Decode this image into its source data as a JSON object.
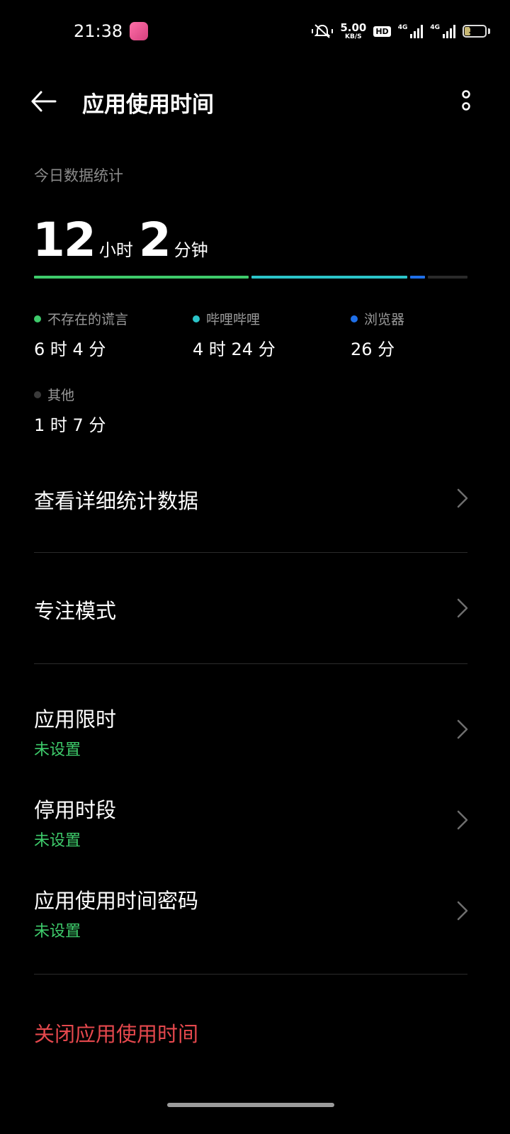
{
  "status_bar": {
    "time": "21:38",
    "net_speed_value": "5.00",
    "net_speed_unit": "KB/S",
    "hd_label": "HD",
    "sim1_type": "4G",
    "sim2_type": "4G",
    "battery_level": "30"
  },
  "header": {
    "title": "应用使用时间"
  },
  "today": {
    "section_label": "今日数据统计",
    "total_hours": "12",
    "hours_unit": "小时",
    "total_minutes": "2",
    "minutes_unit": "分钟",
    "segments": [
      {
        "name": "不存在的谎言",
        "value_minutes": 364,
        "color": "#3ecb6b"
      },
      {
        "name": "哔哩哔哩",
        "value_minutes": 264,
        "color": "#2bc4c9"
      },
      {
        "name": "浏览器",
        "value_minutes": 26,
        "color": "#1f6fe8"
      },
      {
        "name": "其他",
        "value_minutes": 67,
        "color": "#2a2a2a"
      }
    ],
    "apps": [
      {
        "name": "不存在的谎言",
        "value": "6 时 4 分",
        "color": "#3ecb6b"
      },
      {
        "name": "哔哩哔哩",
        "value": "4 时 24 分",
        "color": "#2bc4c9"
      },
      {
        "name": "浏览器",
        "value": "26 分",
        "color": "#1f6fe8"
      },
      {
        "name": "其他",
        "value": "1 时 7 分",
        "color": "#3a3a3a"
      }
    ]
  },
  "menu": {
    "detail_stats": "查看详细统计数据",
    "focus_mode": "专注模式",
    "app_limit": "应用限时",
    "app_limit_status": "未设置",
    "downtime": "停用时段",
    "downtime_status": "未设置",
    "usage_password": "应用使用时间密码",
    "usage_password_status": "未设置",
    "turn_off": "关闭应用使用时间"
  }
}
